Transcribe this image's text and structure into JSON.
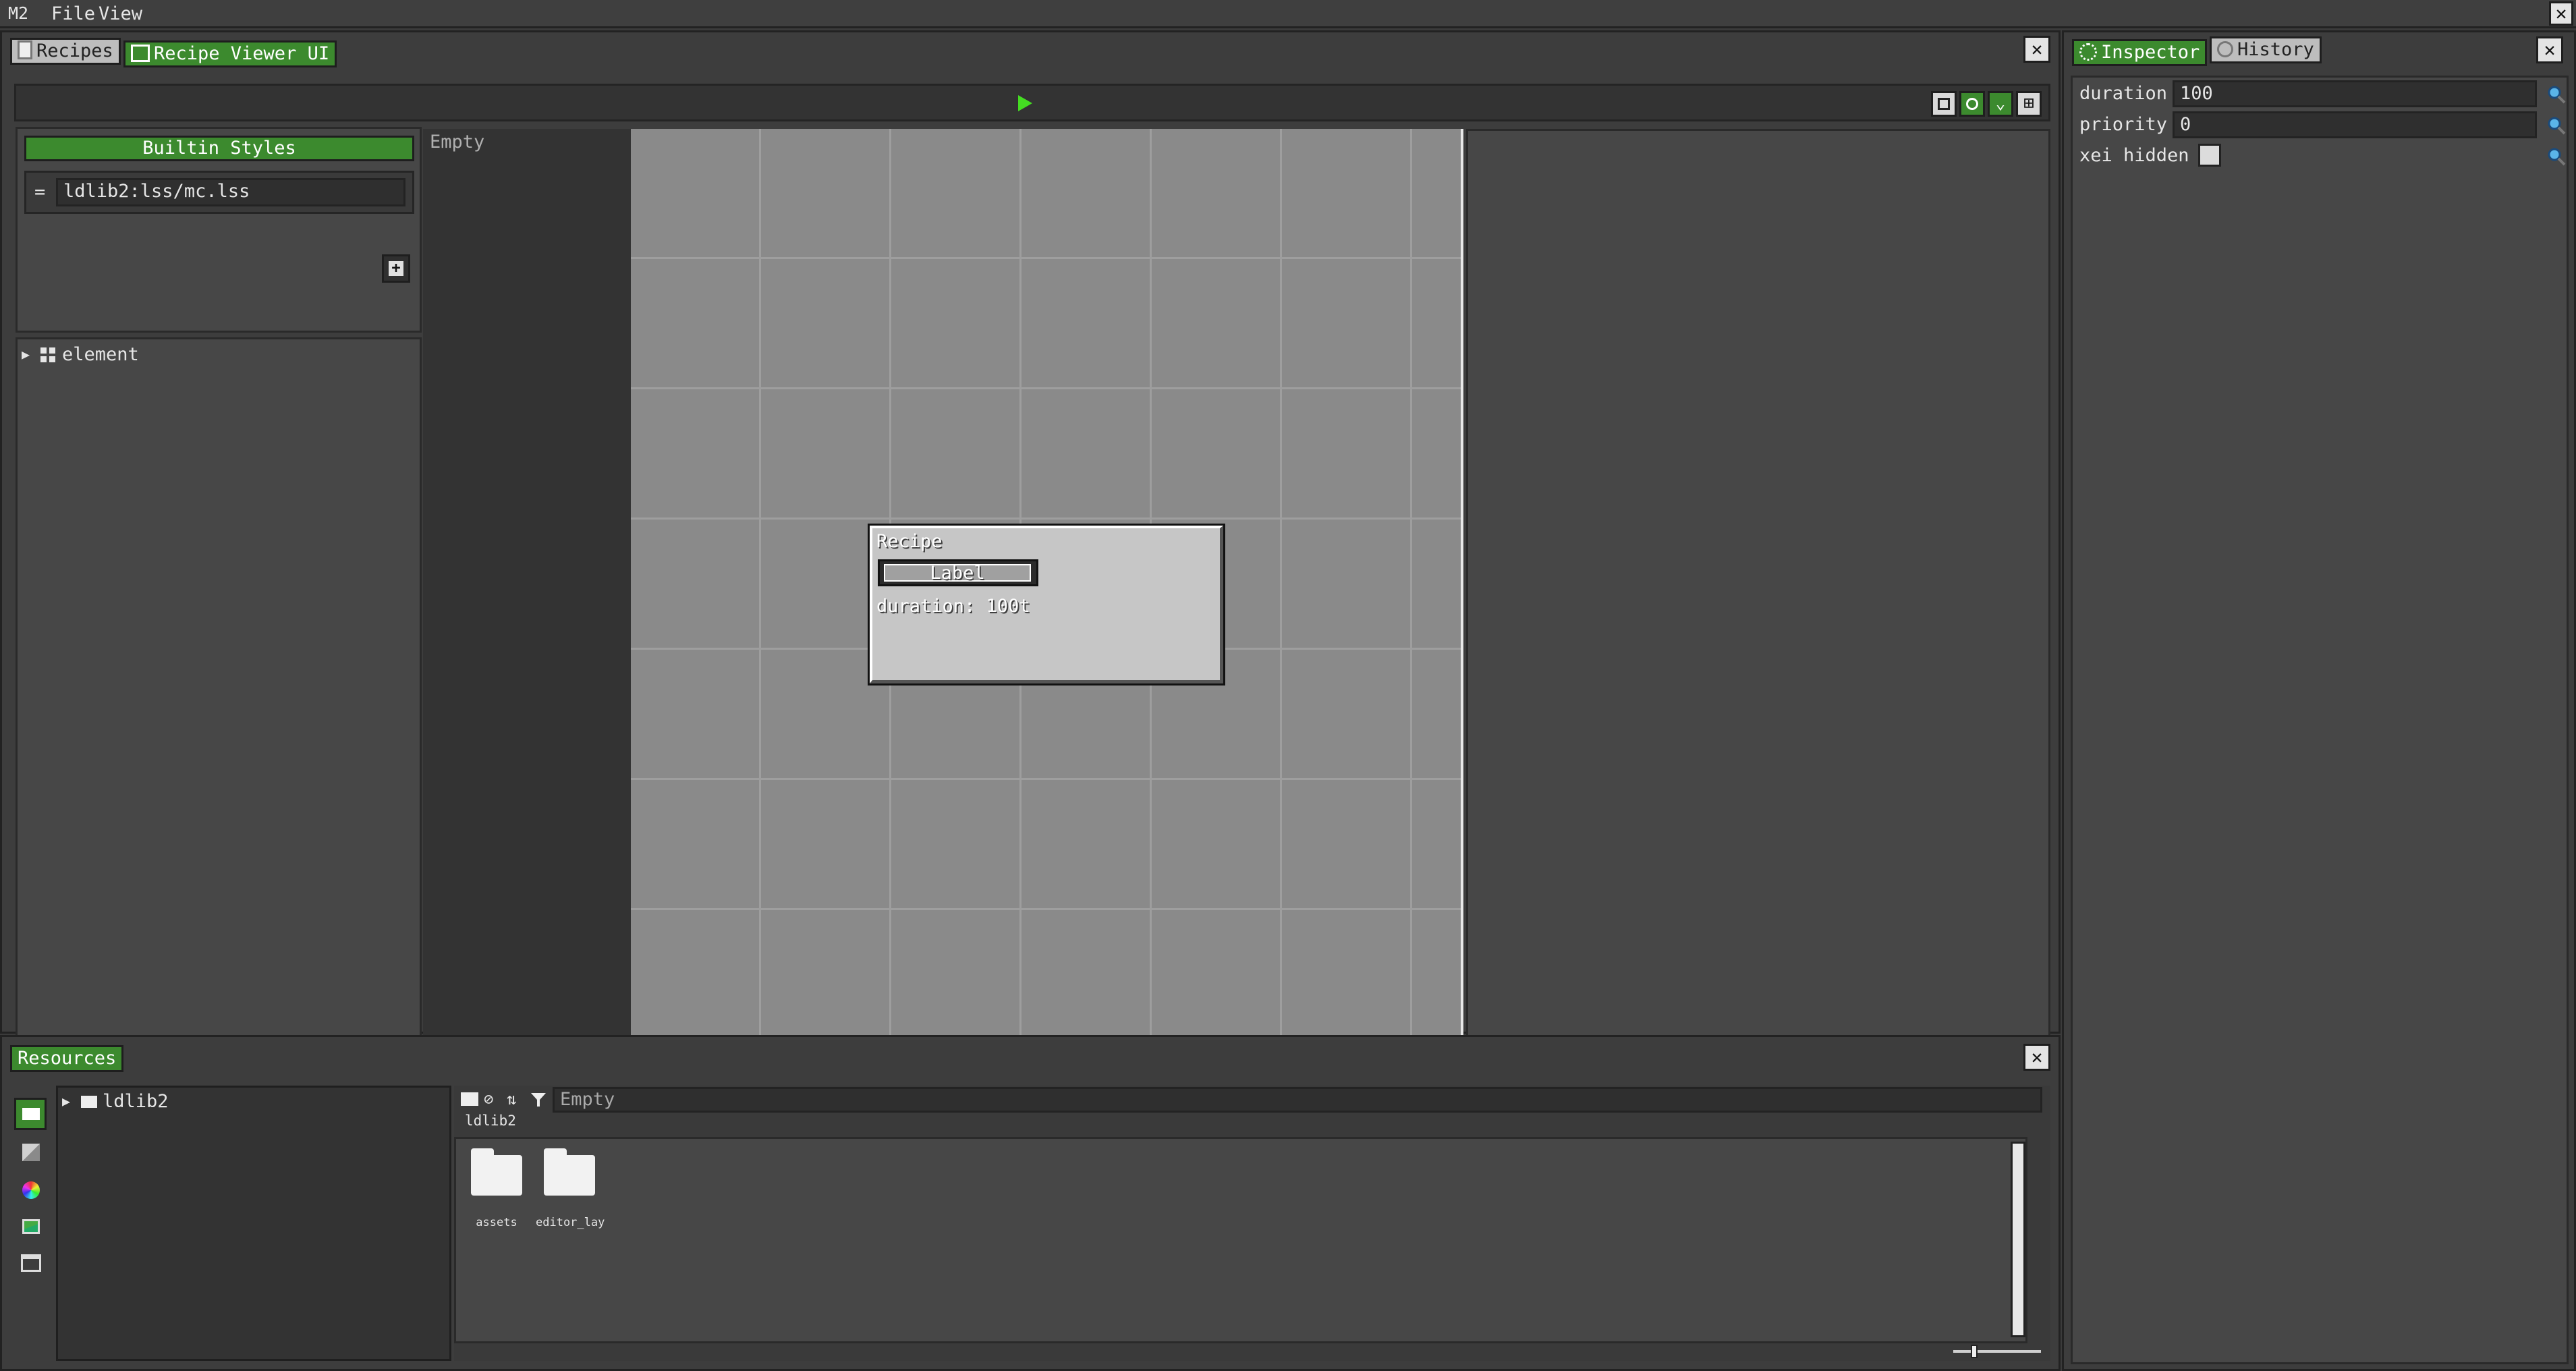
{
  "menubar": {
    "logo": "M2",
    "items": [
      "File",
      "View"
    ]
  },
  "editor": {
    "tabs": [
      {
        "label": "Recipes",
        "icon": "page-icon",
        "active": false
      },
      {
        "label": "Recipe Viewer UI",
        "icon": "window-icon",
        "active": true
      }
    ],
    "styles": {
      "header": "Builtin Styles",
      "entries": [
        {
          "handle": "=",
          "path": "ldlib2:lss/mc.lss"
        }
      ]
    },
    "tree": {
      "root_label": "element"
    },
    "selector_placeholder": "Empty",
    "preview": {
      "title": "Recipe",
      "button_label": "Label",
      "duration_text": "duration: 100t"
    }
  },
  "inspector": {
    "tabs": [
      {
        "label": "Inspector",
        "icon": "gear-icon",
        "active": true
      },
      {
        "label": "History",
        "icon": "clock-icon",
        "active": false
      }
    ],
    "fields": [
      {
        "label": "duration",
        "value": "100"
      },
      {
        "label": "priority",
        "value": "0"
      }
    ],
    "checkbox_field": {
      "label": "xei hidden",
      "checked": false
    }
  },
  "resources": {
    "tab_label": "Resources",
    "tree_root": "ldlib2",
    "filter_placeholder": "Empty",
    "breadcrumb": "ldlib2",
    "items": [
      {
        "name": "assets"
      },
      {
        "name": "editor_lay"
      }
    ]
  },
  "colors": {
    "accent": "#3c8a2e",
    "play": "#44dd22",
    "canvas": "#8a8a8a",
    "panel": "#474747"
  }
}
